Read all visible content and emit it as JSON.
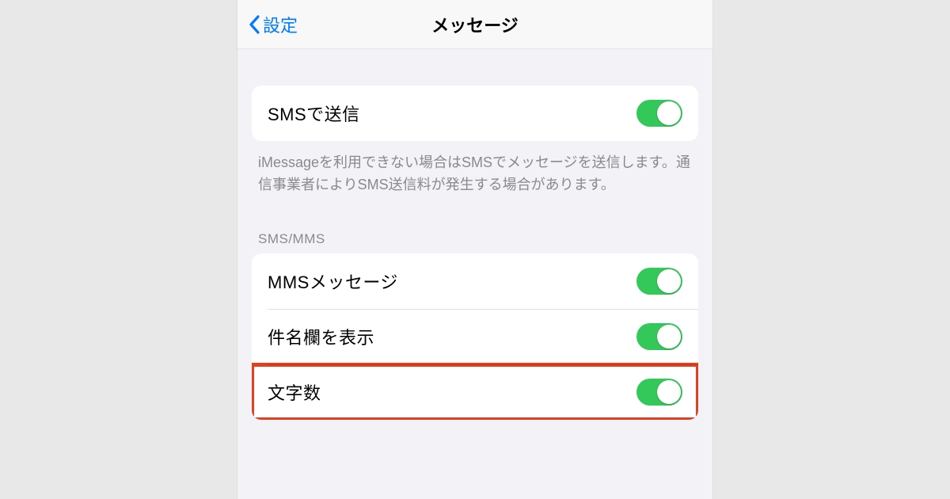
{
  "nav": {
    "back_label": "設定",
    "title": "メッセージ"
  },
  "group_sms": {
    "label": "SMSで送信",
    "footer": "iMessageを利用できない場合はSMSでメッセージを送信します。通信事業者によりSMS送信料が発生する場合があります。"
  },
  "group_smsmms": {
    "header": "SMS/MMS",
    "rows": {
      "mms": "MMSメッセージ",
      "subject": "件名欄を表示",
      "charcount": "文字数"
    }
  }
}
